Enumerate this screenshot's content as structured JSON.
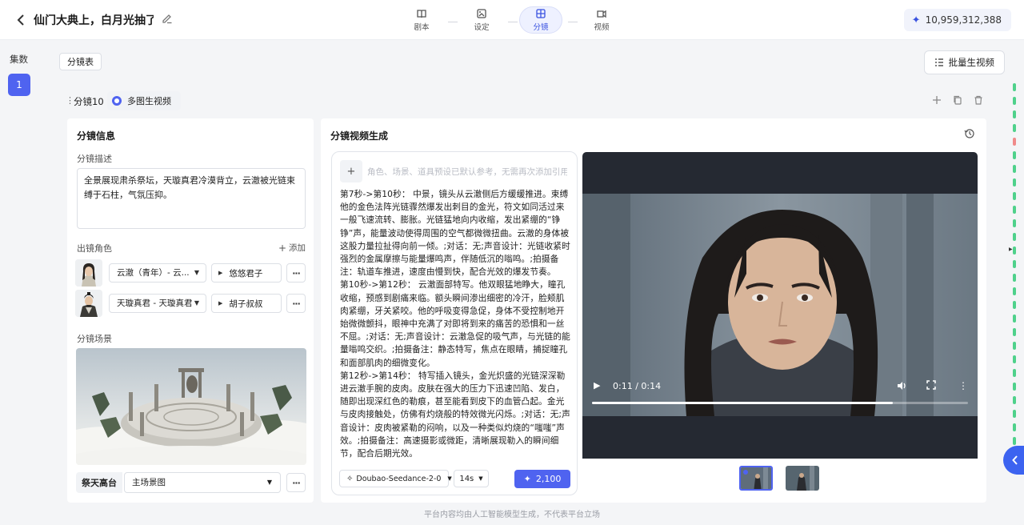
{
  "header": {
    "title": "仙门大典上，白月光抽了...",
    "steps": [
      {
        "label": "剧本",
        "icon": "book-icon"
      },
      {
        "label": "设定",
        "icon": "settings-image-icon"
      },
      {
        "label": "分镜",
        "icon": "storyboard-grid-icon"
      },
      {
        "label": "视频",
        "icon": "video-icon"
      }
    ],
    "active_step": "分镜",
    "credits": "10,959,312,388"
  },
  "sidebar": {
    "episodes_label": "集数",
    "episodes": [
      "1"
    ]
  },
  "toolbar": {
    "storyboard_tab": "分镜表",
    "batch_button": "批量生视频"
  },
  "shot": {
    "name": "分镜10",
    "mode": "多图生视频"
  },
  "info": {
    "title": "分镜信息",
    "desc_label": "分镜描述",
    "description": "全景展现肃杀祭坛，天璇真君冷漠背立，云澈被光链束缚于石柱，气氛压抑。",
    "characters_label": "出镜角色",
    "add_label": "添加",
    "characters": [
      {
        "name": "云澈（青年）- 云...",
        "voice": "悠悠君子"
      },
      {
        "name": "天璇真君 - 天璇真君",
        "voice": "胡子叔叔"
      }
    ],
    "scene_label": "分镜场景",
    "scene_name": "祭天高台",
    "scene_image": "主场景图"
  },
  "gen": {
    "title": "分镜视频生成",
    "ref_placeholder": "角色、场景、道具预设已默认参考，无需再次添加引用",
    "prompt": "第7秒->第10秒： 中景，镜头从云澈侧后方缓缓推进。束缚他的金色法阵光链骤然爆发出刺目的金光，符文如同活过来一般飞速流转、膨胀。光链猛地向内收缩，发出紧绷的“铮铮”声，能量波动使得周围的空气都微微扭曲。云澈的身体被这股力量拉扯得向前一倾。;对话：无;声音设计：光链收紧时强烈的金属摩擦与能量爆鸣声，伴随低沉的嗡鸣。;拍摄备注：轨道车推进，速度由慢到快，配合光效的爆发节奏。\n第10秒->第12秒： 云澈面部特写。他双眼猛地睁大，瞳孔收缩，预感到剧痛来临。额头瞬间渗出细密的冷汗，脸颊肌肉紧绷，牙关紧咬。他的呼吸变得急促，身体不受控制地开始微微颤抖，眼神中充满了对即将到来的痛苦的恐惧和一丝不屈。;对话：无;声音设计：云澈急促的吸气声，与光链的能量嗡鸣交织。;拍摄备注：静态特写，焦点在眼睛，捕捉瞳孔和面部肌肉的细微变化。\n第12秒->第14秒： 特写插入镜头，金光炽盛的光链深深勒进云澈手腕的皮肉。皮肤在强大的压力下迅速凹陷、发白，随即出现深红色的勒痕，甚至能看到皮下的血管凸起。金光与皮肉接触处，仿佛有灼烧般的特效微光闪烁。;对话：无;声音设计：皮肉被紧勒的闷响，以及一种类似灼烧的“嗤嗤”声效。;拍摄备注：高速摄影或微距，清晰展现勒入的瞬间细节，配合后期光效。",
    "model": "Doubao-Seedance-2-0",
    "duration": "14s",
    "cost": "2,100",
    "video": {
      "time": "0:11 / 0:14",
      "progress": 0.8
    }
  },
  "footer": "平台内容均由人工智能模型生成，不代表平台立场",
  "colors": {
    "accent": "#4f63f0",
    "rail_green": "#4fd18b",
    "rail_red": "#f08a8a"
  }
}
